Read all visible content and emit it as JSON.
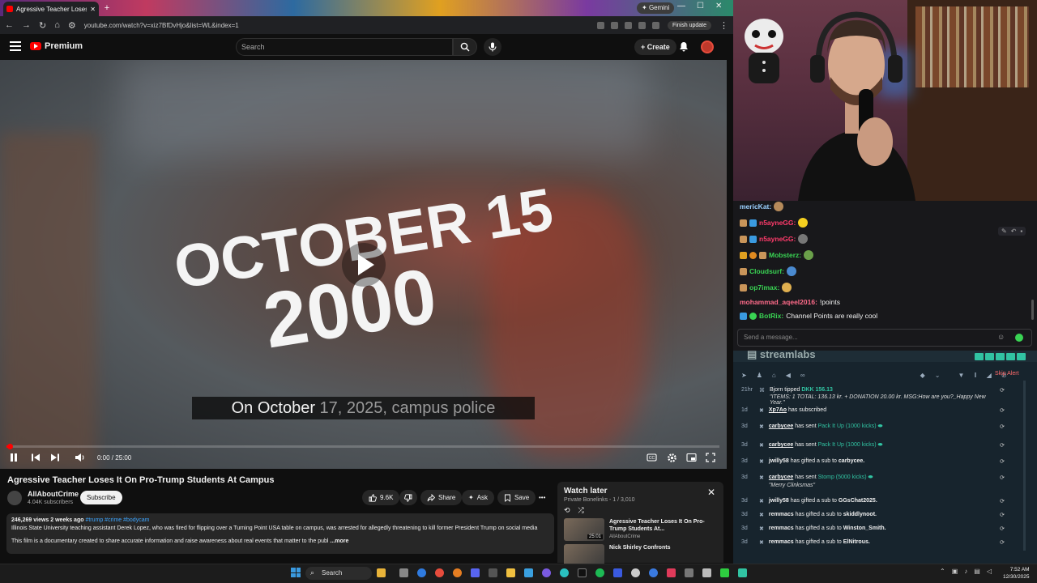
{
  "browser": {
    "tab_title": "Agressive Teacher Loses It On",
    "url": "youtube.com/watch?v=xiz7BfDvHjo&list=WL&index=1",
    "gemini_label": "Gemini",
    "finish_update_label": "Finish update"
  },
  "youtube": {
    "logo_label": "Premium",
    "search_placeholder": "Search",
    "create_label": "Create"
  },
  "video": {
    "overlay_line1": "OCTOBER 15",
    "overlay_line2": "2000",
    "caption_bold": "On October",
    "caption_dim": " 17, 2025, campus police",
    "time": "0:00 / 25:00",
    "progress_fraction": 0.005
  },
  "meta": {
    "title": "Agressive Teacher Loses It On Pro-Trump Students At Campus",
    "channel_name": "AllAboutCrime",
    "channel_subs": "4.04K subscribers",
    "subscribe_label": "Subscribe",
    "likes": "9.6K",
    "share_label": "Share",
    "ask_label": "Ask",
    "save_label": "Save",
    "views_date": "246,269 views  2 weeks ago ",
    "tags": "#trump #crime #bodycam",
    "description_line1": "Illinois State University teaching assistant Derek Lopez, who was fired for flipping over a Turning Point USA table on campus, was arrested for allegedly threatening to kill former President Trump on social media",
    "description_line2": "This film is a documentary created to share accurate information and raise awareness about real events that matter to the publ",
    "more_label": "...more"
  },
  "watch_later": {
    "title": "Watch later",
    "subtitle": "Private Bonelinks - 1 / 3,010",
    "items": [
      {
        "title": "Agressive Teacher Loses It On Pro-Trump Students At...",
        "channel": "AllAboutCrime",
        "duration": "25:01"
      },
      {
        "title": "Nick Shirley Confronts",
        "channel": "",
        "duration": ""
      }
    ]
  },
  "chat": {
    "messages": [
      {
        "user": "mericKat:",
        "text": "",
        "color": "#9ad0ff"
      },
      {
        "user": "n5ayneGG:",
        "text": "",
        "color": "#ff3b6b"
      },
      {
        "user": "n5ayneGG:",
        "text": "",
        "color": "#ff3b6b"
      },
      {
        "user": "Mobsterz:",
        "text": "",
        "color": "#39d353"
      },
      {
        "user": "Cloudsurf:",
        "text": "",
        "color": "#39d353"
      },
      {
        "user": "op7imax:",
        "text": "",
        "color": "#39d353"
      },
      {
        "user": "mohammad_aqeel2016:",
        "text": "!points",
        "color": "#ff6b8a"
      },
      {
        "user": "BotRix:",
        "text": "Channel Points are really cool",
        "color": "#39d353"
      }
    ],
    "input_placeholder": "Send a message..."
  },
  "streamlabs": {
    "logo": "streamlabs",
    "skip_label": "Skip Alert",
    "events": [
      {
        "age": "21hr",
        "user": "Bjorn",
        "pre": "tipped",
        "amount": "DKK 156.13",
        "rest": "",
        "note": "\"ITEMS: 1 TOTAL: 136.13 kr. + DONATION 20.00 kr. MSG:How are you?_Happy New Year.\""
      },
      {
        "age": "1d",
        "user": "Xp7Ao",
        "pre": "has subscribed",
        "amount": "",
        "rest": "",
        "note": ""
      },
      {
        "age": "3d",
        "user": "carbycee",
        "pre": "has sent",
        "amount": "Pack It Up (1000 kicks)",
        "rest": "",
        "note": ""
      },
      {
        "age": "3d",
        "user": "carbycee",
        "pre": "has sent",
        "amount": "Pack It Up (1000 kicks)",
        "rest": "",
        "note": ""
      },
      {
        "age": "3d",
        "user": "jwilly58",
        "pre": "has gifted a sub to",
        "amount": "",
        "rest": "carbycee.",
        "note": ""
      },
      {
        "age": "3d",
        "user": "carbycee",
        "pre": "has sent",
        "amount": "Stomp (5000 kicks)",
        "rest": "",
        "note": "\"Merry Clinksmas\""
      },
      {
        "age": "3d",
        "user": "jwilly58",
        "pre": "has gifted a sub to",
        "amount": "",
        "rest": "GGsChat2025.",
        "note": ""
      },
      {
        "age": "3d",
        "user": "remmacs",
        "pre": "has gifted a sub to",
        "amount": "",
        "rest": "skiddlynoot.",
        "note": ""
      },
      {
        "age": "3d",
        "user": "remmacs",
        "pre": "has gifted a sub to",
        "amount": "",
        "rest": "Winston_Smith.",
        "note": ""
      },
      {
        "age": "3d",
        "user": "remmacs",
        "pre": "has gifted a sub to",
        "amount": "",
        "rest": "ElNitrous.",
        "note": ""
      }
    ]
  },
  "taskbar": {
    "search_label": "Search",
    "time": "7:52 AM",
    "date": "12/30/2025"
  },
  "colors": {
    "yt_red": "#ff0000",
    "twitch_bg": "#18181b",
    "streamlabs_bg": "#17242d",
    "streamlabs_green": "#31c3a2"
  }
}
